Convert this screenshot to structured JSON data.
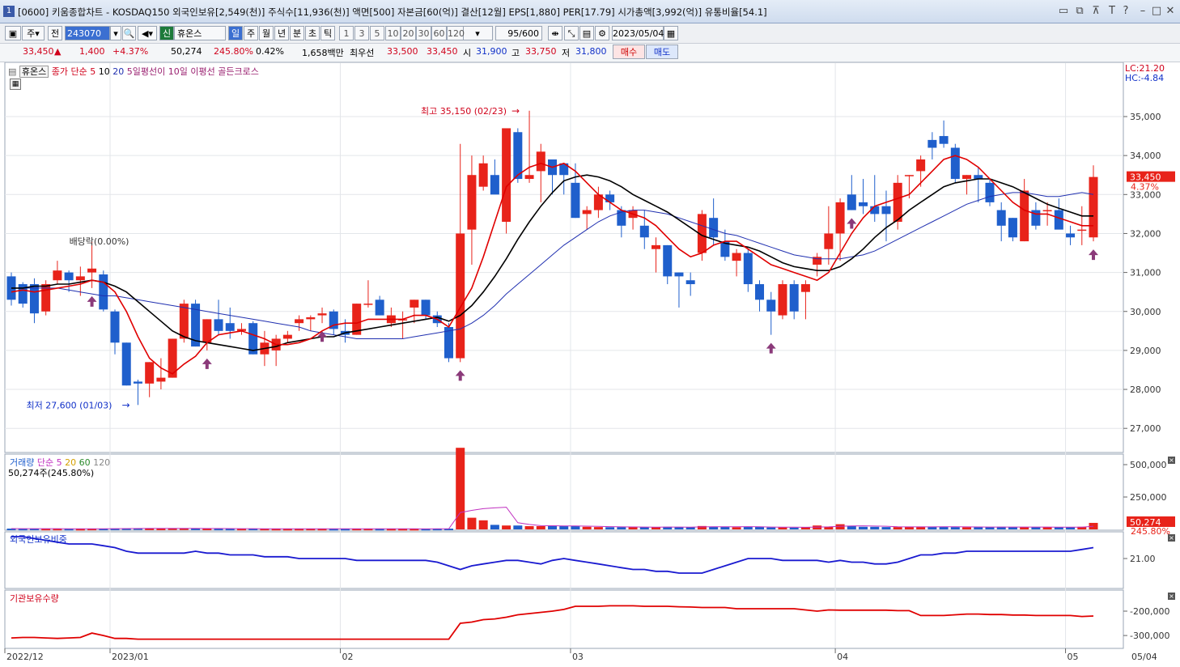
{
  "window": {
    "number": "1",
    "title": "[0600] 키움종합차트 - KOSDAQ150 외국인보유[2,549(천)] 주식수[11,936(천)] 액면[500] 자본금[60(억)] 결산[12월] EPS[1,880] PER[17.79] 시가총액[3,992(억)] 유통비율[54.1]"
  },
  "toolbar": {
    "period_main": "주",
    "period_all": "전",
    "code": "243070",
    "stock_tag": "신",
    "stock_name": "휴온스",
    "period_buttons": [
      "일",
      "주",
      "월",
      "년",
      "분",
      "초",
      "틱"
    ],
    "interval_buttons": [
      "1",
      "3",
      "5",
      "10",
      "20",
      "30",
      "60",
      "120"
    ],
    "count": "95/600",
    "date": "2023/05/04"
  },
  "quote": {
    "price": "33,450",
    "arrow": "▲",
    "change": "1,400",
    "change_pct": "+4.37%",
    "volume": "50,274",
    "volume_pct": "245.80%",
    "turnover": "0.42%",
    "amount": "1,658백만",
    "best_label": "최우선",
    "ask": "33,500",
    "bid": "33,450",
    "open_label": "시",
    "open": "31,900",
    "high_label": "고",
    "high": "33,750",
    "low_label": "저",
    "low": "31,800",
    "buy_label": "매수",
    "sell_label": "매도"
  },
  "price_pane": {
    "legend_name": "휴온스",
    "legend_ma": "종가 단순",
    "ma_periods": [
      "5",
      "10",
      "20"
    ],
    "signal_label": "5일평선이 10일 이평선 골든크로스",
    "lc_label": "LC:21.20",
    "hc_label": "HC:-4.84",
    "high_annotation": "최고 35,150 (02/23)",
    "low_annotation": "최저 27,600 (01/03)",
    "dividend_annotation": "배당락(0.00%)",
    "last_price": "33,450",
    "last_pct": "4.37%",
    "y_ticks": [
      "35,000",
      "34,000",
      "33,000",
      "32,000",
      "31,000",
      "30,000",
      "29,000",
      "28,000",
      "27,000"
    ]
  },
  "volume_pane": {
    "legend_name": "거래량",
    "legend_ma": "단순",
    "ma_periods": [
      "5",
      "20",
      "60",
      "120"
    ],
    "info": "50,274주(245.80%)",
    "y_ticks": [
      "500,000",
      "250,000"
    ],
    "last_value": "50,274",
    "last_pct": "245.80%"
  },
  "foreign_pane": {
    "legend": "외국인보유비중",
    "y_ticks": [
      "21.00"
    ]
  },
  "inst_pane": {
    "legend": "기관보유수량",
    "y_ticks": [
      "-200,000",
      "-300,000"
    ]
  },
  "x_axis": {
    "labels": [
      "2022/12",
      "2023/01",
      "02",
      "03",
      "04",
      "05"
    ],
    "end_label": "05/04"
  },
  "colors": {
    "up": "#e8231a",
    "down": "#1f5fcc",
    "ma5": "#e00000",
    "ma10": "#000000",
    "ma20": "#2030b0",
    "volume_ma": "#c030c0"
  },
  "chart_data": {
    "type": "candlestick",
    "title": "휴온스",
    "ylim": [
      26500,
      35500
    ],
    "candles": [
      [
        30900,
        31000,
        30150,
        30300
      ],
      [
        30700,
        30750,
        30100,
        30200
      ],
      [
        30700,
        30850,
        29700,
        29950
      ],
      [
        30000,
        30800,
        29900,
        30700
      ],
      [
        30800,
        31300,
        30700,
        31050
      ],
      [
        31000,
        31050,
        30500,
        30800
      ],
      [
        30800,
        31150,
        30400,
        30900
      ],
      [
        31000,
        31800,
        30600,
        31100
      ],
      [
        30950,
        31050,
        30000,
        30050
      ],
      [
        30000,
        30050,
        28900,
        29200
      ],
      [
        29200,
        29200,
        28100,
        28100
      ],
      [
        28200,
        28250,
        27600,
        28150
      ],
      [
        28150,
        28700,
        27800,
        28700
      ],
      [
        28200,
        28800,
        28000,
        28300
      ],
      [
        28300,
        29300,
        28300,
        29300
      ],
      [
        29300,
        30300,
        29200,
        30200
      ],
      [
        30200,
        30300,
        29100,
        29100
      ],
      [
        29200,
        29800,
        29000,
        29800
      ],
      [
        29800,
        30300,
        29400,
        29500
      ],
      [
        29700,
        30100,
        29300,
        29500
      ],
      [
        29500,
        29700,
        29400,
        29550
      ],
      [
        29700,
        29750,
        28900,
        28900
      ],
      [
        28900,
        29500,
        28600,
        29200
      ],
      [
        29000,
        29400,
        28600,
        29300
      ],
      [
        29300,
        29500,
        29200,
        29400
      ],
      [
        29700,
        29900,
        29500,
        29800
      ],
      [
        29800,
        29900,
        29500,
        29850
      ],
      [
        29900,
        30100,
        29700,
        29950
      ],
      [
        30000,
        30050,
        29400,
        29550
      ],
      [
        29500,
        29800,
        29200,
        29400
      ],
      [
        29400,
        30200,
        29400,
        30200
      ],
      [
        30200,
        30800,
        30100,
        30200
      ],
      [
        30300,
        30400,
        29900,
        29900
      ],
      [
        29700,
        30100,
        29600,
        29900
      ],
      [
        29800,
        30000,
        29300,
        29800
      ],
      [
        30100,
        30300,
        29700,
        30300
      ],
      [
        30300,
        30300,
        29800,
        29900
      ],
      [
        29900,
        30000,
        29600,
        29700
      ],
      [
        29600,
        29700,
        28700,
        28800
      ],
      [
        28800,
        34300,
        28700,
        32000
      ],
      [
        32100,
        34000,
        31200,
        33500
      ],
      [
        33200,
        34000,
        33100,
        33800
      ],
      [
        33500,
        33900,
        33100,
        33000
      ],
      [
        32300,
        34700,
        32000,
        34700
      ],
      [
        34600,
        34700,
        33300,
        33400
      ],
      [
        33400,
        35150,
        33300,
        33500
      ],
      [
        33600,
        34300,
        32800,
        34100
      ],
      [
        33900,
        33900,
        33000,
        33500
      ],
      [
        33800,
        33800,
        33000,
        33500
      ],
      [
        33300,
        33800,
        32400,
        32400
      ],
      [
        32500,
        32700,
        32100,
        32600
      ],
      [
        32600,
        33200,
        32400,
        33000
      ],
      [
        33000,
        33100,
        32600,
        32800
      ],
      [
        32600,
        32700,
        31900,
        32200
      ],
      [
        32400,
        32700,
        32100,
        32600
      ],
      [
        32200,
        32600,
        31600,
        31900
      ],
      [
        31600,
        31900,
        31000,
        31700
      ],
      [
        31700,
        31700,
        30700,
        30900
      ],
      [
        31000,
        31000,
        30100,
        30900
      ],
      [
        30800,
        31000,
        30400,
        30700
      ],
      [
        31500,
        32600,
        31300,
        32500
      ],
      [
        32400,
        32900,
        31700,
        31900
      ],
      [
        31800,
        32100,
        31300,
        31400
      ],
      [
        31300,
        31600,
        30900,
        31500
      ],
      [
        31500,
        31600,
        30500,
        30700
      ],
      [
        30700,
        30800,
        30000,
        30300
      ],
      [
        30300,
        30500,
        29400,
        30000
      ],
      [
        29900,
        30800,
        29800,
        30700
      ],
      [
        30700,
        30800,
        29800,
        30000
      ],
      [
        30500,
        30800,
        29800,
        30700
      ],
      [
        31200,
        31500,
        30900,
        31400
      ],
      [
        31600,
        32700,
        31200,
        32000
      ],
      [
        32000,
        32900,
        31300,
        32800
      ],
      [
        33000,
        33500,
        32600,
        32600
      ],
      [
        32800,
        33400,
        32500,
        32700
      ],
      [
        32700,
        33500,
        32300,
        32500
      ],
      [
        32700,
        33100,
        31800,
        32500
      ],
      [
        32300,
        33500,
        32100,
        33300
      ],
      [
        33500,
        33500,
        32900,
        33500
      ],
      [
        33600,
        34000,
        33200,
        33900
      ],
      [
        34400,
        34600,
        33900,
        34200
      ],
      [
        34500,
        34900,
        34200,
        34300
      ],
      [
        34200,
        34300,
        33300,
        33400
      ],
      [
        33400,
        33500,
        33000,
        33500
      ],
      [
        33500,
        33700,
        32800,
        33400
      ],
      [
        33300,
        33400,
        32700,
        32800
      ],
      [
        32600,
        32800,
        31800,
        32200
      ],
      [
        32400,
        32400,
        31800,
        31900
      ],
      [
        31800,
        33400,
        31800,
        33100
      ],
      [
        32600,
        32800,
        32100,
        32200
      ],
      [
        32600,
        32800,
        32200,
        32600
      ],
      [
        32600,
        32900,
        32200,
        32100
      ],
      [
        32000,
        32200,
        31700,
        31900
      ],
      [
        32100,
        32700,
        31700,
        32100
      ],
      [
        31900,
        33750,
        31800,
        33450
      ]
    ],
    "ma5": [
      30500,
      30550,
      30500,
      30550,
      30600,
      30650,
      30700,
      30800,
      30750,
      30500,
      30000,
      29350,
      28800,
      28550,
      28400,
      28650,
      28850,
      29200,
      29400,
      29450,
      29500,
      29400,
      29300,
      29150,
      29150,
      29200,
      29300,
      29500,
      29650,
      29700,
      29700,
      29800,
      29800,
      29800,
      29800,
      29900,
      29900,
      29800,
      29600,
      30100,
      30600,
      31400,
      32300,
      33200,
      33500,
      33700,
      33800,
      33700,
      33800,
      33600,
      33300,
      33000,
      32800,
      32600,
      32500,
      32400,
      32200,
      31900,
      31600,
      31400,
      31500,
      31700,
      31800,
      31800,
      31600,
      31400,
      31200,
      31100,
      31000,
      30900,
      30800,
      31000,
      31500,
      32000,
      32400,
      32700,
      32800,
      32900,
      33000,
      33300,
      33600,
      33900,
      34000,
      33900,
      33700,
      33400,
      33100,
      32800,
      32600,
      32500,
      32500,
      32400,
      32300,
      32200,
      32200
    ],
    "ma10": [
      30600,
      30600,
      30650,
      30650,
      30700,
      30700,
      30750,
      30800,
      30750,
      30650,
      30500,
      30250,
      30000,
      29750,
      29500,
      29350,
      29250,
      29200,
      29150,
      29100,
      29050,
      29000,
      29050,
      29100,
      29200,
      29250,
      29300,
      29350,
      29350,
      29450,
      29500,
      29550,
      29600,
      29650,
      29700,
      29750,
      29800,
      29850,
      29750,
      29900,
      30150,
      30500,
      30900,
      31350,
      31850,
      32300,
      32700,
      33050,
      33350,
      33450,
      33500,
      33450,
      33350,
      33200,
      33000,
      32850,
      32700,
      32550,
      32350,
      32150,
      31950,
      31850,
      31750,
      31700,
      31650,
      31550,
      31400,
      31250,
      31150,
      31100,
      31050,
      31050,
      31150,
      31350,
      31600,
      31900,
      32150,
      32350,
      32600,
      32800,
      33000,
      33200,
      33300,
      33350,
      33400,
      33400,
      33300,
      33200,
      33050,
      32900,
      32750,
      32650,
      32550,
      32450,
      32450
    ],
    "ma20": [
      30600,
      30600,
      30600,
      30600,
      30600,
      30550,
      30500,
      30450,
      30400,
      30400,
      30350,
      30300,
      30250,
      30200,
      30150,
      30100,
      30050,
      30000,
      29950,
      29900,
      29850,
      29800,
      29750,
      29700,
      29650,
      29600,
      29500,
      29450,
      29400,
      29350,
      29300,
      29300,
      29300,
      29300,
      29300,
      29350,
      29400,
      29450,
      29500,
      29550,
      29700,
      29900,
      30150,
      30450,
      30700,
      30950,
      31200,
      31450,
      31700,
      31900,
      32100,
      32300,
      32450,
      32550,
      32600,
      32600,
      32550,
      32500,
      32400,
      32300,
      32200,
      32100,
      32000,
      31950,
      31850,
      31750,
      31650,
      31550,
      31450,
      31400,
      31350,
      31350,
      31350,
      31400,
      31450,
      31550,
      31700,
      31850,
      32000,
      32150,
      32300,
      32450,
      32600,
      32750,
      32850,
      32950,
      33000,
      33050,
      33050,
      33000,
      32950,
      32950,
      33000,
      33050,
      33000
    ],
    "volume": [
      6000,
      5000,
      6000,
      5000,
      5000,
      4500,
      4000,
      5500,
      6000,
      7000,
      8000,
      9000,
      7000,
      6000,
      8000,
      8000,
      7000,
      6000,
      5500,
      5000,
      5000,
      6000,
      5000,
      4500,
      4000,
      4000,
      5000,
      4500,
      4000,
      4000,
      5000,
      5000,
      4000,
      4000,
      4000,
      4000,
      4000,
      5000,
      6000,
      630000,
      90000,
      70000,
      35000,
      30000,
      30000,
      25000,
      25000,
      30000,
      25000,
      25000,
      20000,
      18000,
      17000,
      18000,
      20000,
      17000,
      16000,
      20000,
      18000,
      17000,
      26000,
      22000,
      20000,
      17000,
      20000,
      20000,
      15000,
      15000,
      14000,
      16000,
      30000,
      22000,
      40000,
      25000,
      20000,
      20000,
      18000,
      18000,
      20000,
      22000,
      20000,
      20000,
      18000,
      17000,
      18000,
      17000,
      20000,
      18000,
      19000,
      17000,
      16000,
      17000,
      18000,
      20000,
      50274
    ],
    "foreign_pct": [
      21.6,
      21.6,
      21.55,
      21.5,
      21.45,
      21.4,
      21.4,
      21.4,
      21.35,
      21.3,
      21.2,
      21.15,
      21.15,
      21.15,
      21.15,
      21.15,
      21.2,
      21.15,
      21.15,
      21.1,
      21.1,
      21.1,
      21.05,
      21.05,
      21.05,
      21.0,
      21.0,
      21.0,
      21.0,
      21.0,
      20.95,
      20.95,
      20.95,
      20.95,
      20.95,
      20.95,
      20.95,
      20.9,
      20.8,
      20.7,
      20.8,
      20.85,
      20.9,
      20.95,
      20.95,
      20.9,
      20.85,
      20.95,
      21.0,
      20.95,
      20.9,
      20.85,
      20.8,
      20.75,
      20.7,
      20.7,
      20.65,
      20.65,
      20.6,
      20.6,
      20.6,
      20.7,
      20.8,
      20.9,
      21.0,
      21.0,
      21.0,
      20.95,
      20.95,
      20.95,
      20.95,
      20.9,
      20.95,
      20.9,
      20.9,
      20.85,
      20.85,
      20.9,
      21.0,
      21.1,
      21.1,
      21.15,
      21.15,
      21.2,
      21.2,
      21.2,
      21.2,
      21.2,
      21.2,
      21.2,
      21.2,
      21.2,
      21.2,
      21.25,
      21.3
    ],
    "inst_qty": [
      -310000,
      -308000,
      -308000,
      -310000,
      -312000,
      -310000,
      -308000,
      -290000,
      -300000,
      -312000,
      -312000,
      -315000,
      -315000,
      -315000,
      -315000,
      -315000,
      -315000,
      -315000,
      -315000,
      -315000,
      -315000,
      -315000,
      -315000,
      -315000,
      -315000,
      -315000,
      -315000,
      -315000,
      -315000,
      -315000,
      -315000,
      -315000,
      -315000,
      -315000,
      -315000,
      -315000,
      -315000,
      -315000,
      -315000,
      -250000,
      -245000,
      -235000,
      -232000,
      -225000,
      -215000,
      -210000,
      -205000,
      -200000,
      -193000,
      -180000,
      -180000,
      -180000,
      -178000,
      -178000,
      -178000,
      -180000,
      -180000,
      -180000,
      -182000,
      -183000,
      -185000,
      -185000,
      -185000,
      -190000,
      -190000,
      -190000,
      -190000,
      -190000,
      -190000,
      -195000,
      -200000,
      -195000,
      -196000,
      -196000,
      -196000,
      -196000,
      -196000,
      -198000,
      -198000,
      -218000,
      -218000,
      -218000,
      -215000,
      -212000,
      -212000,
      -214000,
      -214000,
      -216000,
      -216000,
      -218000,
      -218000,
      -218000,
      -218000,
      -222000,
      -220000
    ]
  }
}
